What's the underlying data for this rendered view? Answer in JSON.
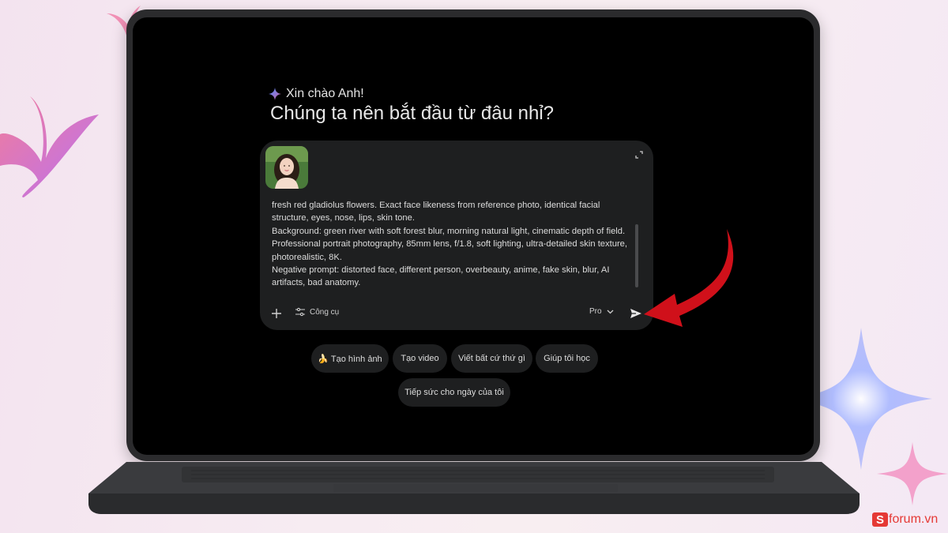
{
  "greeting": {
    "text": "Xin chào Anh!",
    "icon": "gemini-sparkle-icon"
  },
  "headline": "Chúng ta nên bắt đầu từ đâu nhỉ?",
  "prompt": {
    "text": "fresh red gladiolus flowers. Exact face likeness from reference photo, identical facial structure, eyes, nose, lips, skin tone.\nBackground: green river with soft forest blur, morning natural light, cinematic depth of field.\nProfessional portrait photography, 85mm lens, f/1.8, soft lighting, ultra-detailed skin texture, photorealistic, 8K.\nNegative prompt: distorted face, different person, overbeauty, anime, fake skin, blur, AI artifacts, bad anatomy.",
    "attachment": "reference-photo"
  },
  "toolbar": {
    "plus_icon": "plus-icon",
    "tools_label": "Công cụ",
    "tools_icon": "sliders-icon",
    "model_label": "Pro",
    "send_icon": "send-icon"
  },
  "suggestions": [
    {
      "label": "🍌 Tạo hình ảnh"
    },
    {
      "label": "Tạo video"
    },
    {
      "label": "Viết bất cứ thứ gì"
    },
    {
      "label": "Giúp tôi học"
    },
    {
      "label": "Tiếp sức cho ngày của tôi"
    }
  ],
  "brand": {
    "mark": "S",
    "text": "forum.vn"
  },
  "colors": {
    "screen_bg": "#000000",
    "card_bg": "#1e1f20",
    "arrow": "#d0101a",
    "brand": "#e53935"
  }
}
